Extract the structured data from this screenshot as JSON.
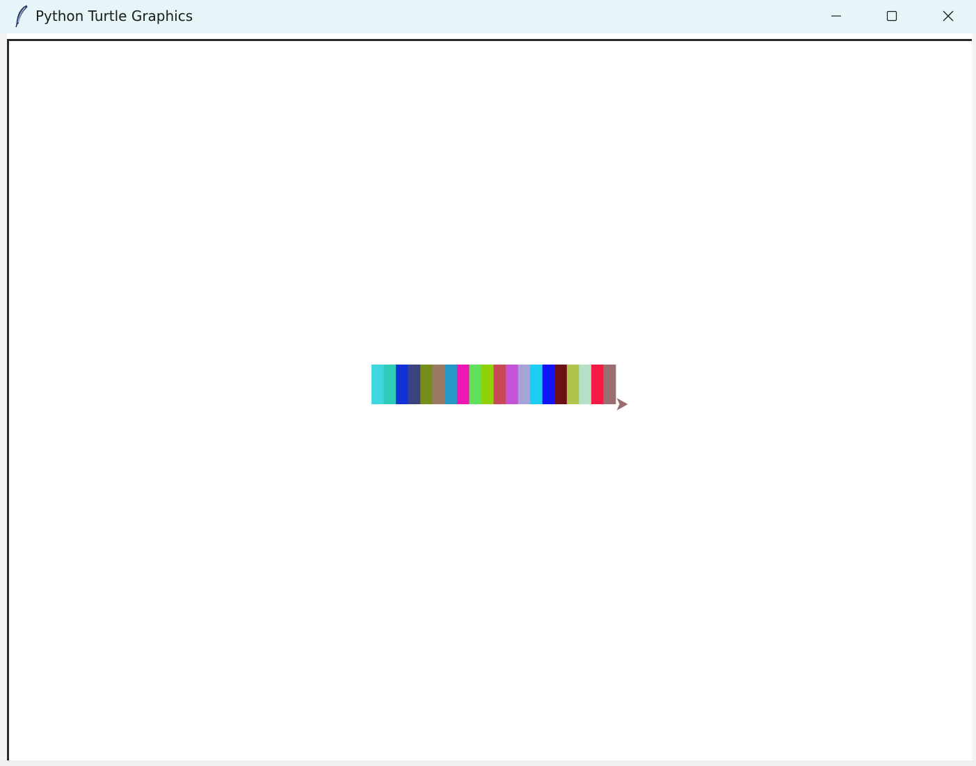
{
  "window": {
    "title": "Python Turtle Graphics",
    "icon": "feather-icon",
    "controls": [
      "minimize-icon",
      "maximize-icon",
      "close-icon"
    ]
  },
  "canvas": {
    "background": "#ffffff",
    "stripes": {
      "colors": [
        "#3fd6de",
        "#2fcbb9",
        "#1032d6",
        "#39437f",
        "#778e1c",
        "#9a7a63",
        "#2598c8",
        "#f016b3",
        "#60e05b",
        "#8fd10a",
        "#c84a58",
        "#c453d8",
        "#a6a3d6",
        "#1dcdf2",
        "#0f13f5",
        "#6d0f16",
        "#aec44d",
        "#b7e1c7",
        "#f51a43",
        "#9a6e70"
      ]
    },
    "turtle": {
      "shape": "turtle-arrow-icon",
      "color": "#9a6e70",
      "heading": "right"
    }
  }
}
